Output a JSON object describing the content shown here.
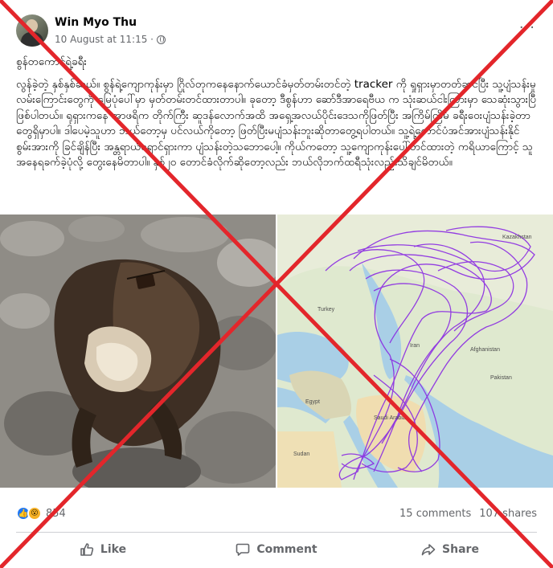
{
  "post": {
    "author": "Win Myo Thu",
    "timestamp": "10 August at 11:15 ·",
    "more_glyph": "···",
    "title": "စွန်တကောင်ရဲ့ခရီး",
    "body": "လွန်ခဲ့တဲ့ နှစ်နှစ်ဆယ်။ စွန်ရဲ့ကျောကုန်းမှာ ဂြိုလ်တုကနေနောက်ယောင်ခံမှတ်တမ်းတင်တဲ့ tracker ကို ရှုရှားမှာတတ်ဆင်ပြီး သူ့ပျံသန်းမှုလမ်းကြောင်းတွေကို မြေပုံပေါ်မှာ မှတ်တမ်းတင်ထားတာပါ။ ခုတော့ ဒီစွန်ဟာ ဆော်ဒီအာရေဗီယ က သုံးဆယ်ငါးကြားမှာ သေဆုံးသွားပြီဖြစ်ပါတယ်။ ရုရှားကနေ အာဖရိက တိုက်ကြီး ဆူဒန်လောက်အထိ အရှေ့အလယ်ပိုင်းဒေသကိုဖြတ်ပြီး အကြိမ်ကြိမ် ခရီးဝေးပျံသန်းခဲ့တာတွေရှိမှာပါ။ ဒါပေမဲ့သူဟာ ဘယ်တော့မှ ပင်လယ်ကိုတော့ ဖြတ်ပြီးမပျံသန်းဘူးဆိုတာတွေ့ရပါတယ်။ သူ့ရဲ့တောင်ပံအင်အားပျံသန်းနိုင်စွမ်းအားကို ခြင်ချိန်ပြီး အန္တရာယ်ရှောင်ရှားကာ ပျံသန်းတဲ့သဘောပေါ့။ ကိုယ်ကတော့ သူ့ကျောကုန်းပေါ်တင်ထားတဲ့ ကရိယာကြောင့် သူအနေရခက်ခဲ့ပုံလို့ တွေးနေမိတာပါ။ နှစ်၂၀ တောင်ခံလိုက်ဆိုတော့လည်း ဘယ်လိုဘက်ထရီသုံးလည်းသိချင်မိတယ်။",
    "reactions_count": "854",
    "comments": "15 comments",
    "shares": "107 shares"
  },
  "icons": {
    "like_reaction": "like-reaction-icon",
    "wow_reaction": "wow-reaction-icon",
    "like_glyph": "👍",
    "wow_glyph": "😮"
  },
  "actions": {
    "like_label": "Like",
    "comment_label": "Comment",
    "share_label": "Share"
  },
  "map": {
    "labels": [
      "Kazakhstan",
      "Turkey",
      "Iran",
      "Egypt",
      "Saudi Arabia",
      "Sudan",
      "Afghanistan",
      "Pakistan"
    ]
  },
  "colors": {
    "link_grey": "#65676b",
    "like_blue": "#2078f4",
    "wow_yellow": "#f7b125",
    "track_purple": "#8a2be2",
    "cross_red": "#e3262b"
  }
}
